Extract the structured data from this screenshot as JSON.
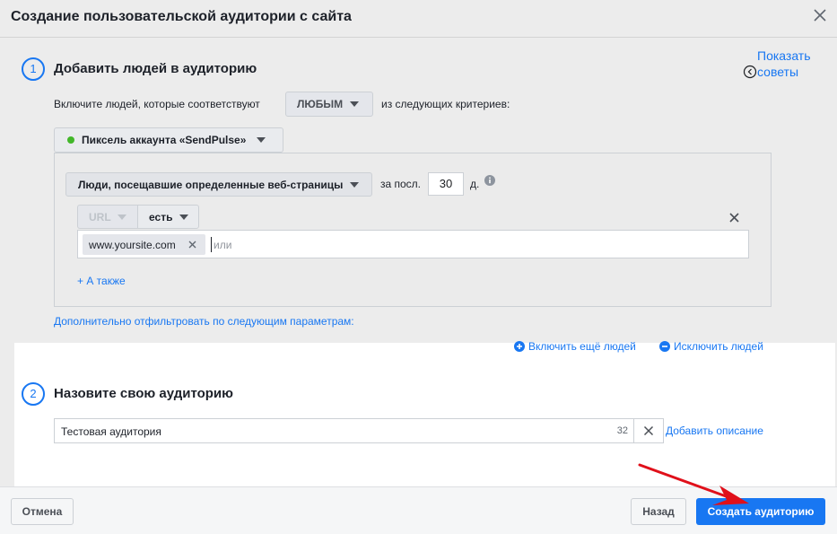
{
  "dialog": {
    "title": "Создание пользовательской аудитории с сайта"
  },
  "tips": {
    "line1": "Показать",
    "line2": "советы"
  },
  "step1": {
    "number": "1",
    "title": "Добавить людей в аудиторию",
    "include_prefix": "Включите людей, которые соответствуют",
    "match_value": "ЛЮБЫМ",
    "include_suffix": "из следующих критериев:",
    "pixel_label": "Пиксель аккаунта «SendPulse»",
    "pixel_status_color": "#42b72a",
    "rule": {
      "event_label": "Люди, посещавшие определенные веб-страницы",
      "period_prefix": "за посл.",
      "period_value": "30",
      "period_unit": "д.",
      "field_label": "URL",
      "operator_label": "есть",
      "token_value": "www.yoursite.com",
      "or_placeholder": "или",
      "add_also": "+ А также"
    },
    "more_filters": "Дополнительно отфильтровать по следующим параметрам:",
    "include_more": "Включить ещё людей",
    "exclude": "Исключить людей"
  },
  "step2": {
    "number": "2",
    "title": "Назовите свою аудиторию",
    "name_value": "Тестовая аудитория",
    "char_count": "32",
    "add_description": "Добавить описание"
  },
  "footer": {
    "cancel": "Отмена",
    "back": "Назад",
    "create": "Создать аудиторию"
  },
  "colors": {
    "accent": "#1877f2",
    "arrow": "#e0101a"
  }
}
